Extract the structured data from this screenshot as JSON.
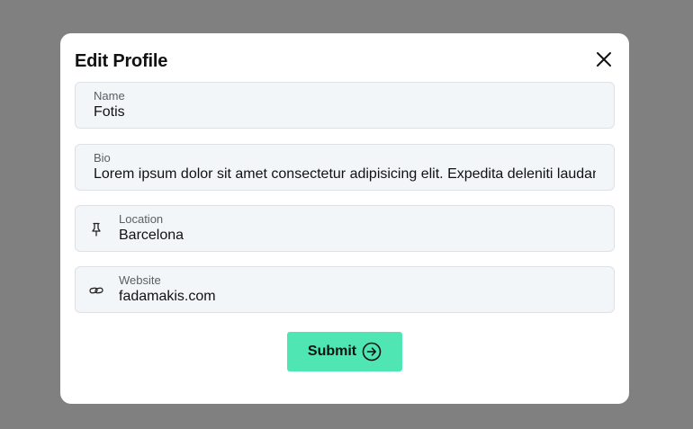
{
  "modal": {
    "title": "Edit Profile",
    "close_icon": "close-icon"
  },
  "fields": {
    "name": {
      "label": "Name",
      "value": "Fotis"
    },
    "bio": {
      "label": "Bio",
      "value": "Lorem ipsum dolor sit amet consectetur adipisicing elit. Expedita deleniti laudantium"
    },
    "location": {
      "label": "Location",
      "value": "Barcelona",
      "icon": "pin-icon"
    },
    "website": {
      "label": "Website",
      "value": "fadamakis.com",
      "icon": "link-icon"
    }
  },
  "submit": {
    "label": "Submit",
    "icon": "arrow-right-circle-icon"
  },
  "colors": {
    "backdrop": "#808080",
    "modal": "#ffffff",
    "field_bg": "#f3f6f9",
    "accent": "#4fe6b3"
  }
}
